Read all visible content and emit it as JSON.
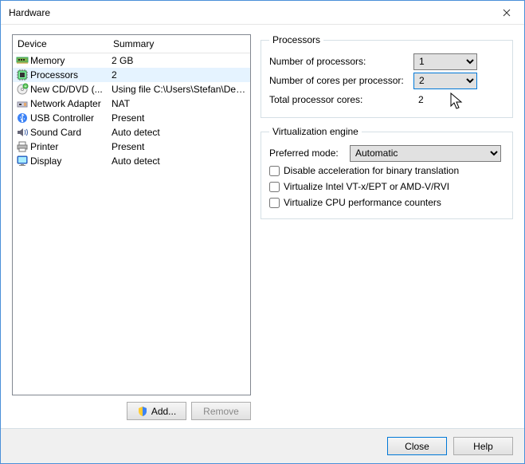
{
  "window": {
    "title": "Hardware"
  },
  "columns": {
    "device": "Device",
    "summary": "Summary"
  },
  "devices": [
    {
      "icon": "memory-icon",
      "name": "Memory",
      "summary": "2 GB"
    },
    {
      "icon": "cpu-icon",
      "name": "Processors",
      "summary": "2",
      "selected": true
    },
    {
      "icon": "cd-icon",
      "name": "New CD/DVD (...",
      "summary": "Using file C:\\Users\\Stefan\\Deskto..."
    },
    {
      "icon": "network-icon",
      "name": "Network Adapter",
      "summary": "NAT"
    },
    {
      "icon": "usb-icon",
      "name": "USB Controller",
      "summary": "Present"
    },
    {
      "icon": "sound-icon",
      "name": "Sound Card",
      "summary": "Auto detect"
    },
    {
      "icon": "printer-icon",
      "name": "Printer",
      "summary": "Present"
    },
    {
      "icon": "display-icon",
      "name": "Display",
      "summary": "Auto detect"
    }
  ],
  "buttons": {
    "add": "Add...",
    "remove": "Remove",
    "close": "Close",
    "help": "Help"
  },
  "processors": {
    "legend": "Processors",
    "num_processors_label": "Number of processors:",
    "num_processors_value": "1",
    "cores_per_label": "Number of cores per processor:",
    "cores_per_value": "2",
    "total_label": "Total processor cores:",
    "total_value": "2"
  },
  "virt": {
    "legend": "Virtualization engine",
    "preferred_mode_label": "Preferred mode:",
    "preferred_mode_value": "Automatic",
    "chk1": "Disable acceleration for binary translation",
    "chk2": "Virtualize Intel VT-x/EPT or AMD-V/RVI",
    "chk3": "Virtualize CPU performance counters"
  }
}
